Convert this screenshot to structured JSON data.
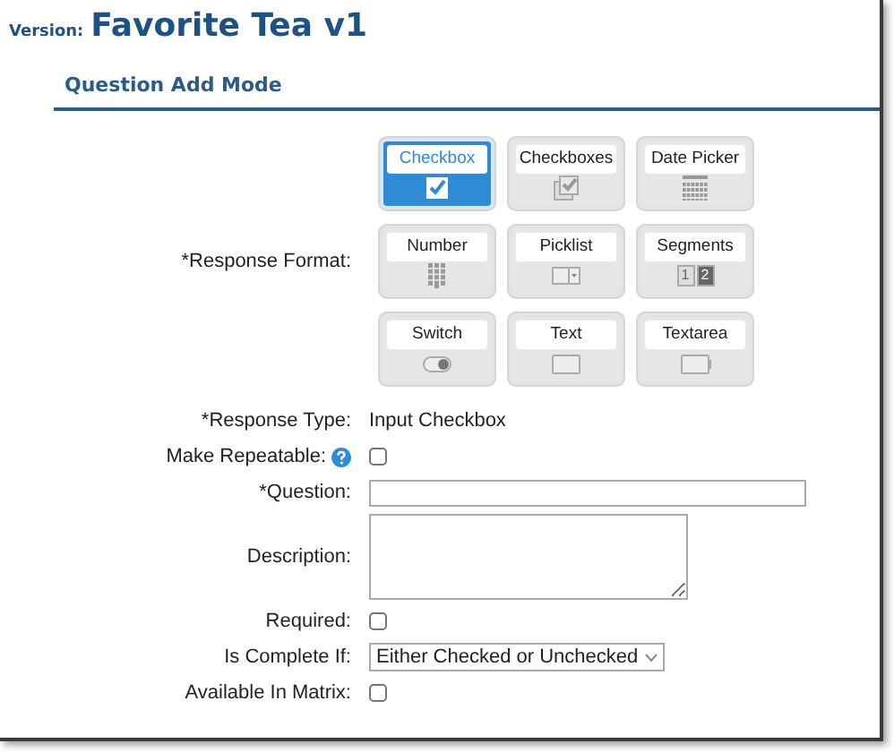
{
  "header": {
    "prefix": "Version:",
    "title": "Favorite Tea v1"
  },
  "section": {
    "title": "Question Add Mode"
  },
  "response_format": {
    "label": "*Response Format:",
    "tiles": [
      {
        "label": "Checkbox",
        "kind": "checkbox",
        "selected": true
      },
      {
        "label": "Checkboxes",
        "kind": "checkboxes",
        "selected": false
      },
      {
        "label": "Date Picker",
        "kind": "date",
        "selected": false
      },
      {
        "label": "Number",
        "kind": "number",
        "selected": false
      },
      {
        "label": "Picklist",
        "kind": "picklist",
        "selected": false
      },
      {
        "label": "Segments",
        "kind": "segments",
        "selected": false,
        "segments": [
          "1",
          "2"
        ]
      },
      {
        "label": "Switch",
        "kind": "switch",
        "selected": false
      },
      {
        "label": "Text",
        "kind": "text",
        "selected": false
      },
      {
        "label": "Textarea",
        "kind": "textarea",
        "selected": false
      }
    ]
  },
  "fields": [
    {
      "label": "*Response Type:",
      "kind": "static",
      "value": "Input Checkbox"
    },
    {
      "label": "Make Repeatable:",
      "kind": "checkbox",
      "checked": false,
      "help": true
    },
    {
      "label": "*Question:",
      "kind": "input"
    },
    {
      "label": "Description:",
      "kind": "textarea"
    },
    {
      "label": "Required:",
      "kind": "checkbox",
      "checked": false
    },
    {
      "label": "Is Complete If:",
      "kind": "select",
      "value": "Either Checked or Unchecked"
    },
    {
      "label": "Available In Matrix:",
      "kind": "checkbox",
      "checked": false
    }
  ]
}
